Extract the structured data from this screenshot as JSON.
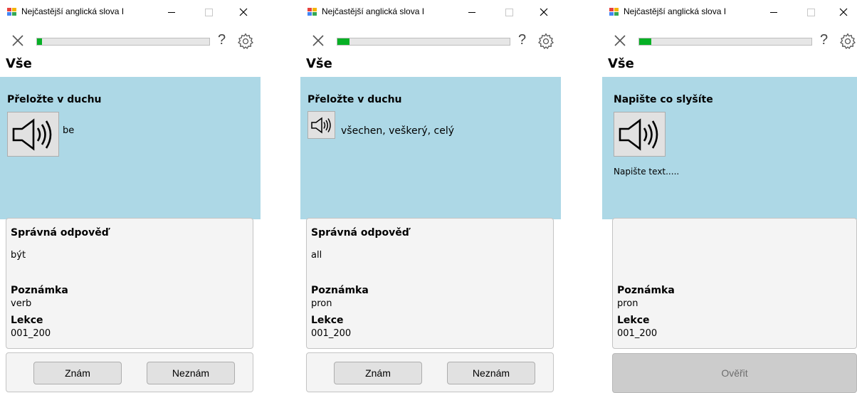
{
  "windows": [
    {
      "title": "Nejčastější anglická slova I",
      "progress_fraction": 0.03,
      "help": "?",
      "heading": "Vše",
      "prompt": "Přeložte v duchu",
      "word": "be",
      "answer_label": "Správná odpověď",
      "answer": "být",
      "note_label": "Poznámka",
      "note": "verb",
      "lesson_label": "Lekce",
      "lesson": "001_200",
      "know_label": "Znám",
      "unknown_label": "Neznám"
    },
    {
      "title": "Nejčastější anglická slova I",
      "progress_fraction": 0.07,
      "help": "?",
      "heading": "Vše",
      "prompt": "Přeložte v duchu",
      "word": "všechen, veškerý, celý",
      "answer_label": "Správná odpověď",
      "answer": "all",
      "note_label": "Poznámka",
      "note": "pron",
      "lesson_label": "Lekce",
      "lesson": "001_200",
      "know_label": "Znám",
      "unknown_label": "Neznám"
    },
    {
      "title": "Nejčastější anglická slova I",
      "progress_fraction": 0.07,
      "help": "?",
      "heading": "Vše",
      "prompt": "Napište co slyšíte",
      "input_value": "Napište text.....",
      "note_label": "Poznámka",
      "note": "pron",
      "lesson_label": "Lekce",
      "lesson": "001_200",
      "verify_label": "Ověřit"
    }
  ],
  "colors": {
    "content_background": "#add8e6",
    "progress_fill": "#06b025",
    "panel_background": "#f4f4f4",
    "disabled_button": "#cccccc"
  },
  "icons": [
    "app-icon",
    "close-icon",
    "help-icon",
    "gear-icon",
    "speaker-icon"
  ]
}
